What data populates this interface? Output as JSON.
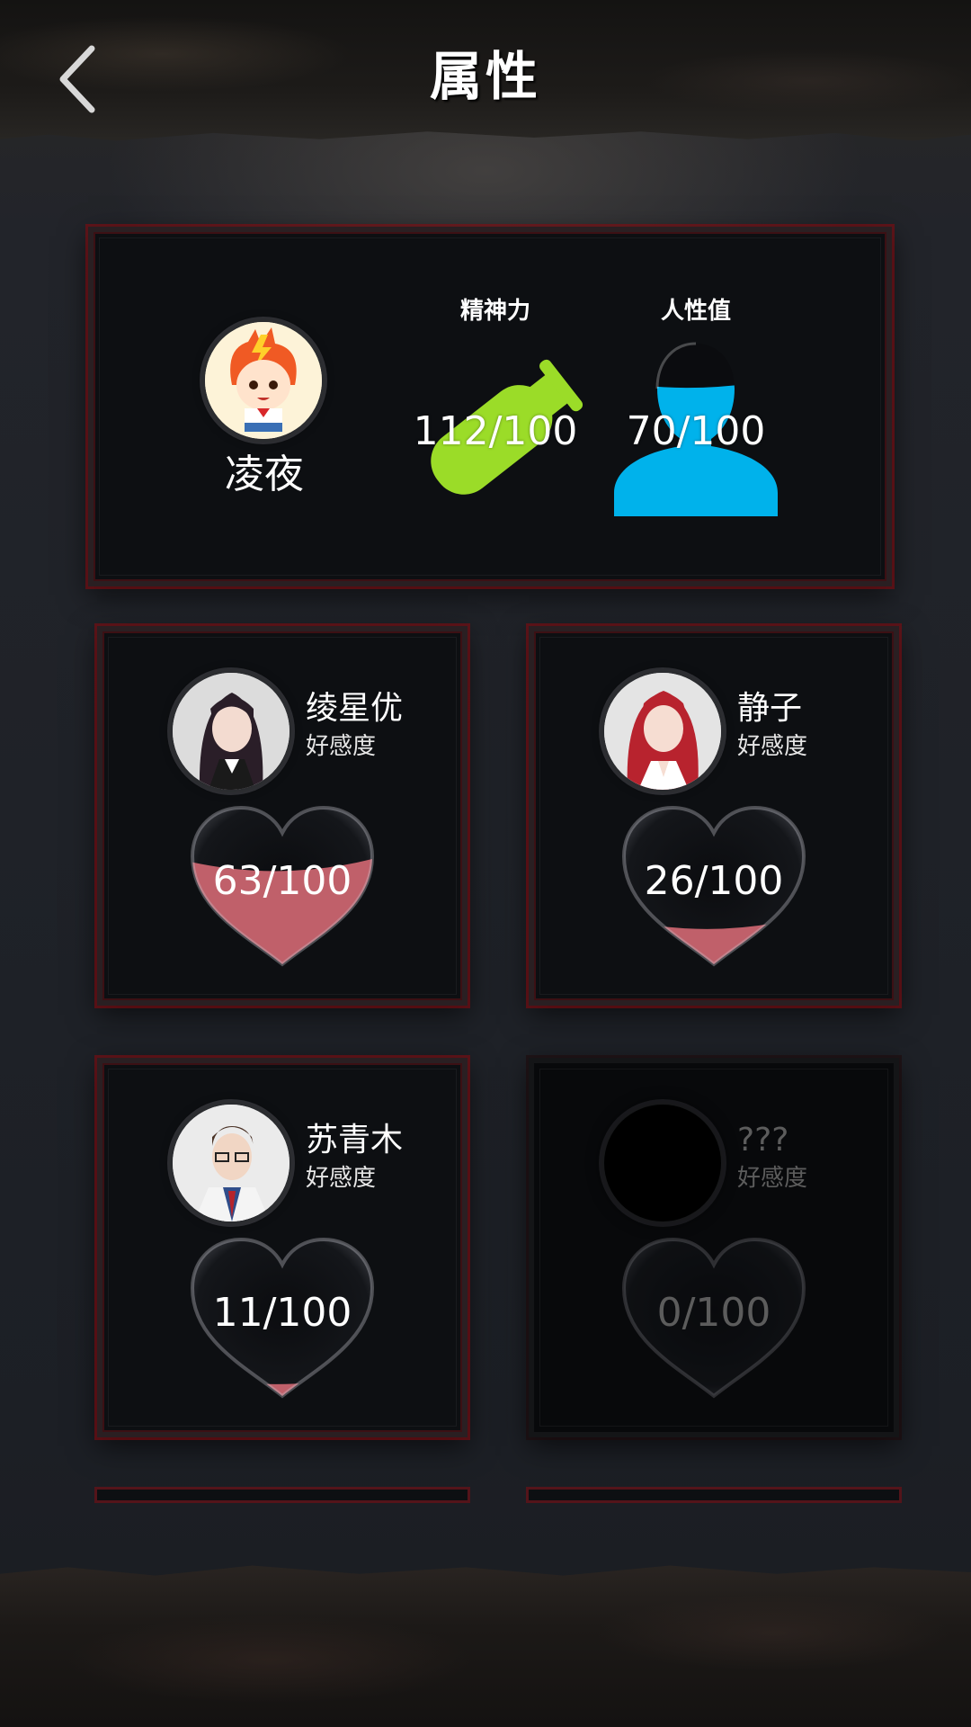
{
  "header": {
    "title": "属性"
  },
  "player": {
    "name": "凌夜",
    "stats": [
      {
        "label": "精神力",
        "value_text": "112/100",
        "value": 112,
        "max": 100,
        "color": "#9bdc28",
        "icon": "syringe-icon"
      },
      {
        "label": "人性值",
        "value_text": "70/100",
        "value": 70,
        "max": 100,
        "color": "#00b2eb",
        "icon": "person-silhouette-icon"
      }
    ]
  },
  "characters": [
    {
      "name": "绫星优",
      "subtitle": "好感度",
      "value_text": "63/100",
      "value": 63,
      "max": 100,
      "locked": false
    },
    {
      "name": "静子",
      "subtitle": "好感度",
      "value_text": "26/100",
      "value": 26,
      "max": 100,
      "locked": false
    },
    {
      "name": "苏青木",
      "subtitle": "好感度",
      "value_text": "11/100",
      "value": 11,
      "max": 100,
      "locked": false
    },
    {
      "name": "???",
      "subtitle": "好感度",
      "value_text": "0/100",
      "value": 0,
      "max": 100,
      "locked": true
    }
  ],
  "colors": {
    "heart_fill": "#c0606a",
    "card_border": "#8c0a0f"
  }
}
